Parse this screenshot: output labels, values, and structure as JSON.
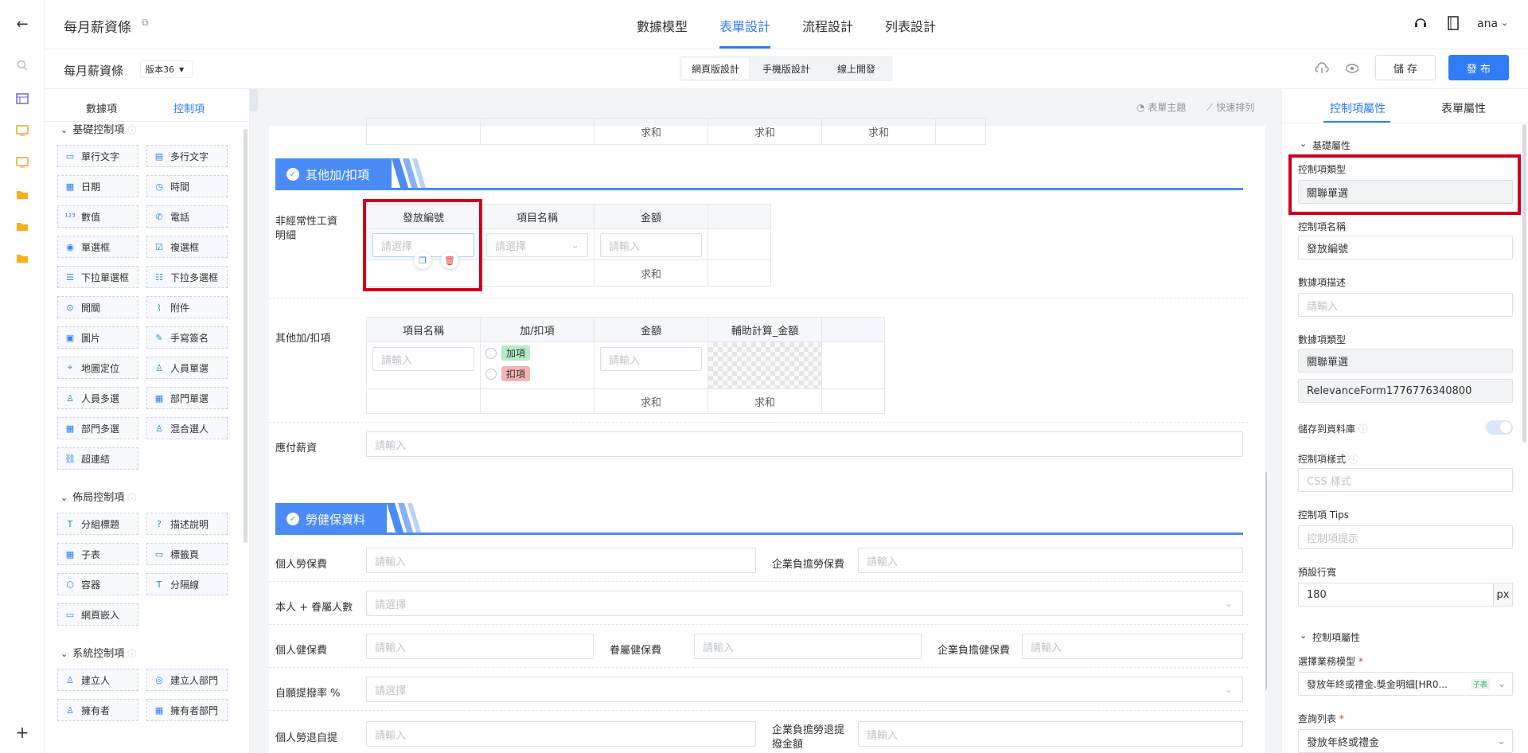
{
  "colors": {
    "accent": "#2f7cf6",
    "section": "#4a8bf5",
    "highlight": "#d0021b",
    "add_tag": "#b7ebc7",
    "sub_tag": "#f6b3b3"
  },
  "header": {
    "title": "每月薪資條",
    "nav_tabs": [
      "數據模型",
      "表單設計",
      "流程設計",
      "列表設計"
    ],
    "active_tab": "表單設計",
    "user": "ana"
  },
  "subheader": {
    "form_name": "每月薪資條",
    "version": "版本36",
    "modes": [
      "網頁版設計",
      "手機版設計",
      "線上開發"
    ],
    "save": "儲 存",
    "publish": "發 布"
  },
  "left_panel": {
    "tabs": [
      "數據項",
      "控制項"
    ],
    "sections": [
      {
        "title": "基礎控制項",
        "items": [
          [
            "單行文字",
            "多行文字"
          ],
          [
            "日期",
            "時間"
          ],
          [
            "數值",
            "電話"
          ],
          [
            "單選框",
            "複選框"
          ],
          [
            "下拉單選框",
            "下拉多選框"
          ],
          [
            "開關",
            "附件"
          ],
          [
            "圖片",
            "手寫簽名"
          ],
          [
            "地圖定位",
            "人員單選"
          ],
          [
            "人員多選",
            "部門單選"
          ],
          [
            "部門多選",
            "混合選人"
          ],
          [
            "超連結"
          ]
        ]
      },
      {
        "title": "佈局控制項",
        "items": [
          [
            "分組標題",
            "描述說明"
          ],
          [
            "子表",
            "標籤頁"
          ],
          [
            "容器",
            "分隔線"
          ],
          [
            "網頁嵌入"
          ]
        ]
      },
      {
        "title": "系統控制項",
        "items": [
          [
            "建立人",
            "建立人部門"
          ],
          [
            "擁有者",
            "擁有者部門"
          ]
        ]
      }
    ]
  },
  "canvas": {
    "toolbar": [
      "表單主題",
      "快速排列"
    ],
    "sum": "求和",
    "sections": [
      "其他加/扣項",
      "勞健保資料"
    ],
    "table1": {
      "label": "非經常性工資明細",
      "headers": [
        "發放編號",
        "項目名稱",
        "金額"
      ],
      "placeholders": [
        "請選擇",
        "請選擇",
        "請輸入"
      ]
    },
    "table2": {
      "label": "其他加/扣項",
      "headers": [
        "項目名稱",
        "加/扣項",
        "金額",
        "輔助計算_金額"
      ],
      "placeholders": [
        "請輸入",
        "請輸入"
      ],
      "options": [
        "加項",
        "扣項"
      ]
    },
    "fields": {
      "payable": {
        "label": "應付薪資",
        "ph": "請輸入"
      },
      "labor_ins": {
        "label": "個人勞保費",
        "ph": "請輸入"
      },
      "corp_labor_ins": {
        "label": "企業負擔勞保費",
        "ph": "請輸入"
      },
      "dependents": {
        "label": "本人 + 眷屬人數",
        "ph": "請選擇"
      },
      "health_ins": {
        "label": "個人健保費",
        "ph": "請輸入"
      },
      "dep_health": {
        "label": "眷屬健保費",
        "ph": "請輸入"
      },
      "corp_health": {
        "label": "企業負擔健保費",
        "ph": "請輸入"
      },
      "vol_rate": {
        "label": "自願提撥率 %",
        "ph": "請選擇"
      },
      "pension": {
        "label": "個人勞退自提",
        "ph": "請輸入"
      },
      "corp_pension_1": {
        "label": "企業負擔勞退提",
        "ph": "請輸入"
      },
      "corp_pension_2": {
        "label": "撥金額"
      }
    }
  },
  "right_panel": {
    "tabs": [
      "控制項屬性",
      "表單屬性"
    ],
    "basic_title": "基礎屬性",
    "ctl_type": {
      "label": "控制項類型",
      "value": "關聯單選"
    },
    "ctl_name": {
      "label": "控制項名稱",
      "value": "發放編號"
    },
    "data_desc": {
      "label": "數據項描述",
      "ph": "請輸入"
    },
    "data_type": {
      "label": "數據項類型",
      "value": "關聯單選",
      "form_id": "RelevanceForm1776776340800"
    },
    "save_db": {
      "label": "儲存到資料庫"
    },
    "style": {
      "label": "控制項樣式",
      "ph": "CSS 樣式"
    },
    "tips": {
      "label": "控制項 Tips",
      "ph": "控制項提示"
    },
    "row_height": {
      "label": "預設行寬",
      "value": "180",
      "unit": "px"
    },
    "props_title": "控制項屬性",
    "biz_model": {
      "label": "選擇業務模型",
      "value": "發放年終或禮金.獎金明細[HR0...",
      "tag": "子表"
    },
    "query_list": {
      "label": "查詢列表",
      "value": "發放年終或禮金"
    }
  }
}
